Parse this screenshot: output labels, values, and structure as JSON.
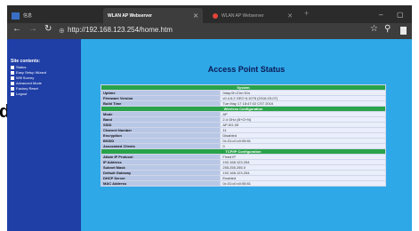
{
  "browser": {
    "tabs": [
      {
        "label": "信息"
      },
      {
        "label": "WLAN AP Webserver"
      },
      {
        "label": "WLAN AP Webserver"
      }
    ],
    "url": "http://192.168.123.254/home.htm"
  },
  "sidebar": {
    "title": "Site contents:",
    "items": [
      "Status",
      "Easy Setup Wizard",
      "Wifi Survey",
      "Advanced Mode",
      "Factory Reset",
      "Logout"
    ]
  },
  "main": {
    "title": "Access Point Status",
    "sections": [
      {
        "name": "System",
        "rows": [
          {
            "label": "Uptime",
            "value": "0day:0h:21m:51s"
          },
          {
            "label": "Firmware Version",
            "value": "v0.4.6.2 GEO 6.1078 (2016-03-07)"
          },
          {
            "label": "Build Time",
            "value": "Tue May 17 18:47:02 CST 2016"
          }
        ]
      },
      {
        "name": "Wireless Configuration",
        "rows": [
          {
            "label": "Mode",
            "value": "AP"
          },
          {
            "label": "Band",
            "value": "2.4 GHz (B+G+N)"
          },
          {
            "label": "SSID",
            "value": "AP-5G-05"
          },
          {
            "label": "Channel Number",
            "value": "11"
          },
          {
            "label": "Encryption",
            "value": "Disabled"
          },
          {
            "label": "BSSID",
            "value": "0c:31:c0:c0:05:81"
          },
          {
            "label": "Associated Clients",
            "value": "0"
          }
        ]
      },
      {
        "name": "TCP/IP Configuration",
        "rows": [
          {
            "label": "Attain IP Protocol",
            "value": "Fixed IP"
          },
          {
            "label": "IP Address",
            "value": "192.168.123.254"
          },
          {
            "label": "Subnet Mask",
            "value": "255.255.255.0"
          },
          {
            "label": "Default Gateway",
            "value": "192.168.123.254"
          },
          {
            "label": "DHCP Server",
            "value": "Enabled"
          },
          {
            "label": "MAC Address",
            "value": "0c:31:c0:c0:05:81"
          }
        ]
      }
    ]
  },
  "left_edge_text": "d"
}
